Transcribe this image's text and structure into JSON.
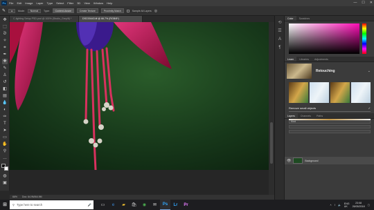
{
  "menu": {
    "app_logo": "Ps",
    "items": [
      "File",
      "Edit",
      "Image",
      "Layer",
      "Type",
      "Select",
      "Filter",
      "3D",
      "View",
      "Window",
      "Help"
    ],
    "window_controls": [
      "—",
      "☐",
      "✕"
    ]
  },
  "options": {
    "mode_label": "Mode:",
    "mode_value": "Normal",
    "type_label": "Type:",
    "type_buttons": [
      "Content-Aware",
      "Create Texture",
      "Proximity Match"
    ],
    "sample_all_label": "Sample All Layers"
  },
  "doc_tabs": [
    {
      "label": "C-lighting Setup PSD.psd @ 100% (Studio_Grey/8) *",
      "active": false
    },
    {
      "label": "DSC00443.tif @ 66.7% (RGB/8*)",
      "active": true
    }
  ],
  "status": {
    "zoom": "66%",
    "doc": "Doc: 64.9M/64.9M"
  },
  "right_panel": {
    "color_tabs": [
      "Color",
      "Swatches"
    ],
    "learn_tabs": [
      "Learn",
      "Libraries",
      "Adjustments"
    ],
    "learn_title": "Retouching",
    "tutorial_label": "Remove small objects",
    "layers_tabs": [
      "Layers",
      "Channels",
      "Paths"
    ],
    "layer_name": "Background",
    "panel_search_label": "Kind"
  },
  "taskbar": {
    "search_placeholder": "Type here to search",
    "lang": "ENG\nUK",
    "time": "23:08",
    "date": "26/05/2018"
  },
  "colors": {
    "canvas_bg": "#19401c",
    "petal": "#c0124a",
    "stamen": "#d8315e",
    "pollen": "#d6d3c7",
    "accent": "#31a8ff"
  }
}
